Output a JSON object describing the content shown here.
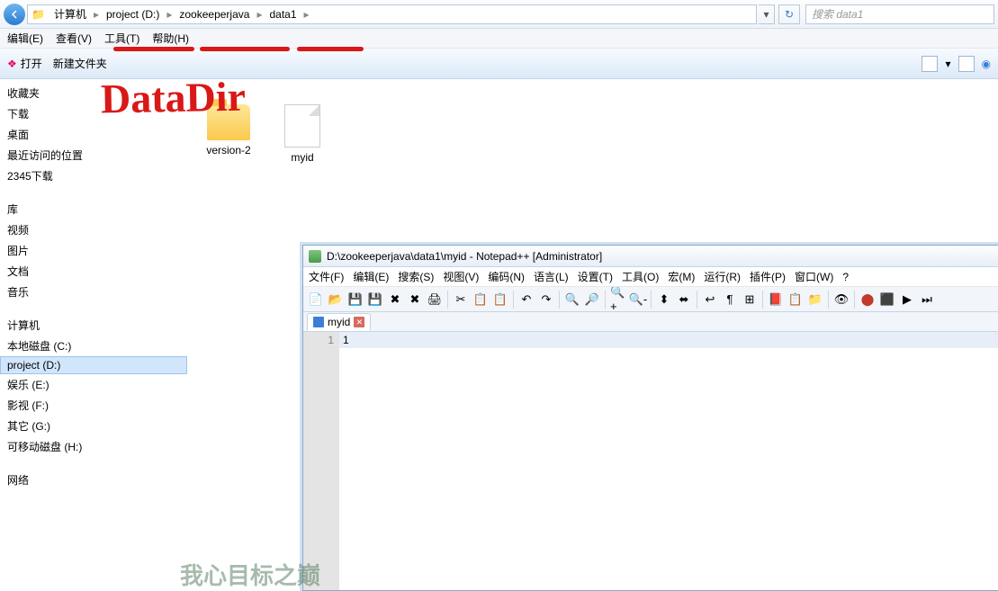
{
  "breadcrumb": {
    "root": "计算机",
    "b1": "project (D:)",
    "b2": "zookeeperjava",
    "b3": "data1"
  },
  "search": {
    "placeholder": "搜索 data1"
  },
  "menu": {
    "edit": "编辑(E)",
    "view": "查看(V)",
    "tools": "工具(T)",
    "help": "帮助(H)"
  },
  "toolbar": {
    "open": "打开",
    "newfolder": "新建文件夹"
  },
  "sidebar": {
    "fav": "收藏夹",
    "f1": "下载",
    "f2": "桌面",
    "f3": "最近访问的位置",
    "f4": "2345下载",
    "lib": "库",
    "l1": "视频",
    "l2": "图片",
    "l3": "文档",
    "l4": "音乐",
    "pc": "计算机",
    "d1": "本地磁盘 (C:)",
    "d2": "project (D:)",
    "d3": "娱乐 (E:)",
    "d4": "影视 (F:)",
    "d5": "其它 (G:)",
    "d6": "可移动磁盘 (H:)",
    "net": "网络"
  },
  "files": {
    "f1": "version-2",
    "f2": "myid"
  },
  "annotation": {
    "text": "DataDir"
  },
  "npp": {
    "title": "D:\\zookeeperjava\\data1\\myid - Notepad++ [Administrator]",
    "menu": {
      "m1": "文件(F)",
      "m2": "编辑(E)",
      "m3": "搜索(S)",
      "m4": "视图(V)",
      "m5": "编码(N)",
      "m6": "语言(L)",
      "m7": "设置(T)",
      "m8": "工具(O)",
      "m9": "宏(M)",
      "m10": "运行(R)",
      "m11": "插件(P)",
      "m12": "窗口(W)",
      "m13": "?"
    },
    "tab": "myid",
    "line_num": "1",
    "content": "1"
  },
  "watermark": "我心目标之巅"
}
